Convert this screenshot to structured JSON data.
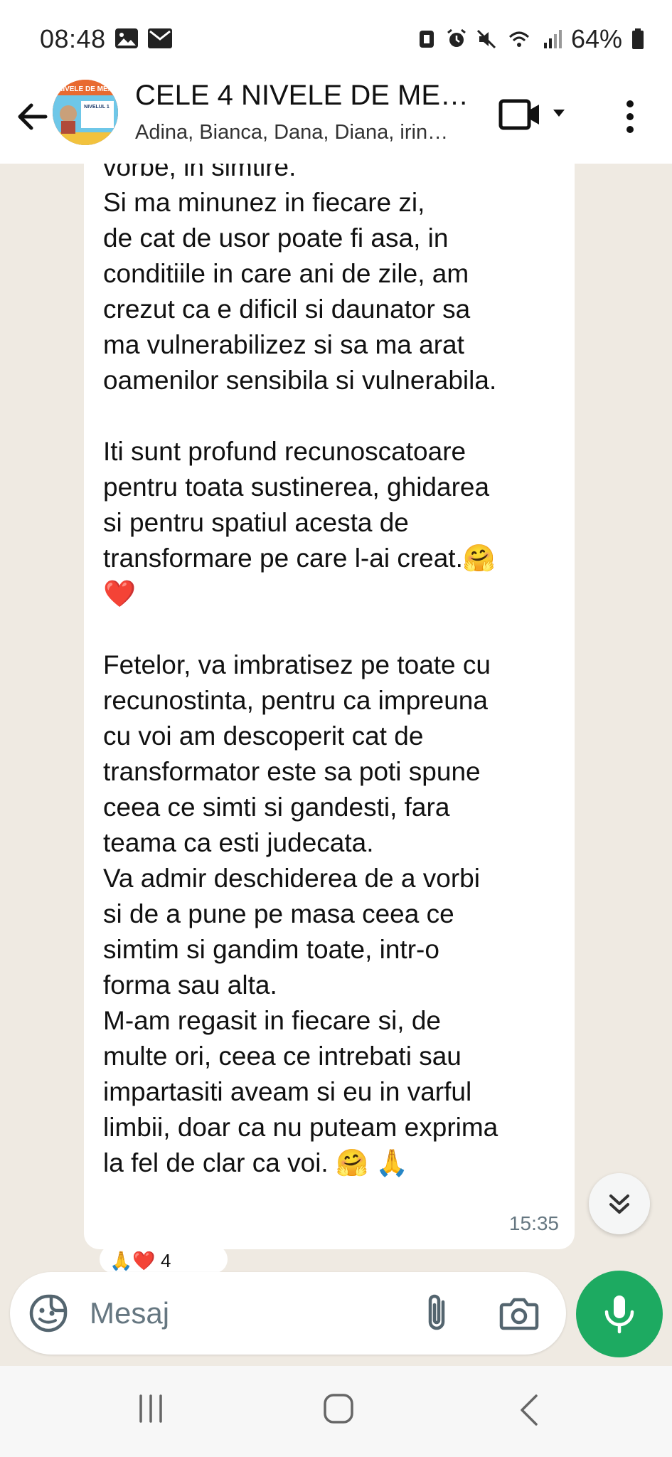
{
  "status_bar": {
    "time": "08:48",
    "battery": "64%"
  },
  "header": {
    "title": "CELE 4 NIVELE DE ME…",
    "participants": "Adina, Bianca, Dana, Diana, irin…",
    "avatar_text": "NIVELE DE MEN",
    "avatar_subtext": "NIVELUL 1"
  },
  "message": {
    "text": "vorbe, in simtire.\nSi ma minunez in fiecare zi,\nde cat de usor poate fi asa, in\nconditiile in care ani de zile, am\ncrezut ca e dificil si daunator sa\nma vulnerabilizez si sa ma arat\noamenilor sensibila si vulnerabila.\n\nIti sunt profund recunoscatoare\npentru toata sustinerea, ghidarea\nsi pentru spatiul acesta de\ntransformare pe care l-ai creat.🤗\n❤️\n\nFetelor, va imbratisez pe toate cu\nrecunostinta, pentru ca impreuna\ncu voi am descoperit cat de\ntransformator este sa poti spune\nceea ce simti si gandesti, fara\nteama ca esti judecata.\nVa admir deschiderea de a vorbi\nsi de a pune pe masa ceea ce\nsimtim si gandim toate, intr-o\nforma sau alta.\nM-am regasit in fiecare si, de\nmulte ori, ceea ce intrebati sau\nimpartasiti aveam si eu in varful\nlimbii, doar ca nu puteam exprima\nla fel de clar ca voi. 🤗 🙏",
    "time": "15:35",
    "reactions": "🙏❤️ 4"
  },
  "composer": {
    "placeholder": "Mesaj"
  },
  "icons": {
    "back": "arrow-left-icon",
    "video": "video-call-icon",
    "menu": "more-vertical-icon",
    "sticker": "sticker-icon",
    "attach": "paperclip-icon",
    "camera": "camera-icon",
    "mic": "microphone-icon",
    "scroll": "double-chevron-down-icon"
  },
  "colors": {
    "chat_background": "#efeae2",
    "accent_green": "#1daa61",
    "bubble": "#ffffff"
  }
}
